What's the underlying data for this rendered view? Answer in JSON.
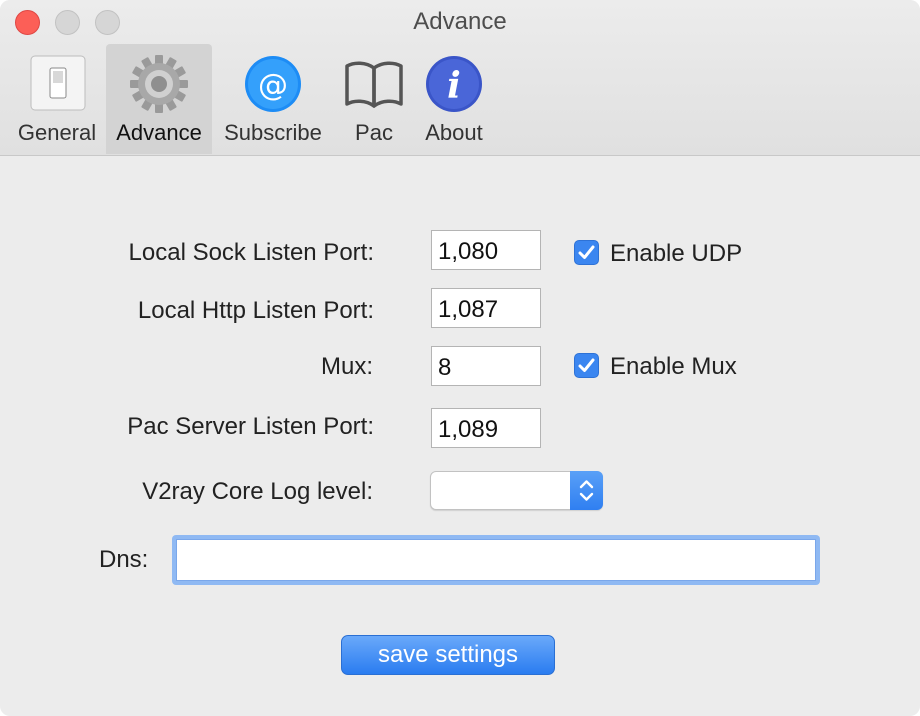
{
  "window": {
    "title": "Advance"
  },
  "toolbar": {
    "tabs": [
      {
        "label": "General",
        "icon": "switch-icon"
      },
      {
        "label": "Advance",
        "icon": "gear-icon",
        "active": true
      },
      {
        "label": "Subscribe",
        "icon": "at-sign-icon"
      },
      {
        "label": "Pac",
        "icon": "book-icon"
      },
      {
        "label": "About",
        "icon": "info-icon"
      }
    ]
  },
  "form": {
    "sock_port_label": "Local Sock Listen Port:",
    "sock_port_value": "1,080",
    "enable_udp_label": "Enable UDP",
    "enable_udp_checked": true,
    "http_port_label": "Local Http Listen Port:",
    "http_port_value": "1,087",
    "mux_label": "Mux:",
    "mux_value": "8",
    "enable_mux_label": "Enable Mux",
    "enable_mux_checked": true,
    "pac_port_label": "Pac Server Listen Port:",
    "pac_port_value": "1,089",
    "log_level_label": "V2ray Core Log level:",
    "log_level_value": "",
    "dns_label": "Dns:",
    "dns_value": ""
  },
  "actions": {
    "save_label": "save settings"
  },
  "colors": {
    "accent": "#3b86f0",
    "close": "#fc5f57",
    "background": "#ececec"
  }
}
